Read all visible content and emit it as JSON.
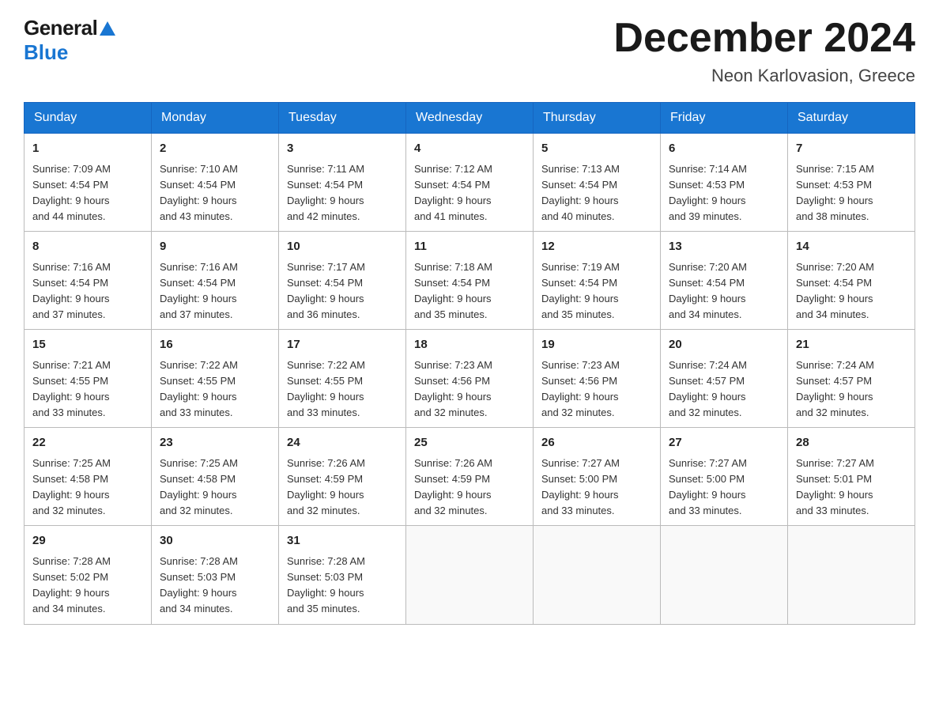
{
  "header": {
    "logo_general": "General",
    "logo_blue": "Blue",
    "month_title": "December 2024",
    "location": "Neon Karlovasion, Greece"
  },
  "weekdays": [
    "Sunday",
    "Monday",
    "Tuesday",
    "Wednesday",
    "Thursday",
    "Friday",
    "Saturday"
  ],
  "weeks": [
    [
      {
        "day": "1",
        "sunrise": "7:09 AM",
        "sunset": "4:54 PM",
        "daylight": "9 hours and 44 minutes."
      },
      {
        "day": "2",
        "sunrise": "7:10 AM",
        "sunset": "4:54 PM",
        "daylight": "9 hours and 43 minutes."
      },
      {
        "day": "3",
        "sunrise": "7:11 AM",
        "sunset": "4:54 PM",
        "daylight": "9 hours and 42 minutes."
      },
      {
        "day": "4",
        "sunrise": "7:12 AM",
        "sunset": "4:54 PM",
        "daylight": "9 hours and 41 minutes."
      },
      {
        "day": "5",
        "sunrise": "7:13 AM",
        "sunset": "4:54 PM",
        "daylight": "9 hours and 40 minutes."
      },
      {
        "day": "6",
        "sunrise": "7:14 AM",
        "sunset": "4:53 PM",
        "daylight": "9 hours and 39 minutes."
      },
      {
        "day": "7",
        "sunrise": "7:15 AM",
        "sunset": "4:53 PM",
        "daylight": "9 hours and 38 minutes."
      }
    ],
    [
      {
        "day": "8",
        "sunrise": "7:16 AM",
        "sunset": "4:54 PM",
        "daylight": "9 hours and 37 minutes."
      },
      {
        "day": "9",
        "sunrise": "7:16 AM",
        "sunset": "4:54 PM",
        "daylight": "9 hours and 37 minutes."
      },
      {
        "day": "10",
        "sunrise": "7:17 AM",
        "sunset": "4:54 PM",
        "daylight": "9 hours and 36 minutes."
      },
      {
        "day": "11",
        "sunrise": "7:18 AM",
        "sunset": "4:54 PM",
        "daylight": "9 hours and 35 minutes."
      },
      {
        "day": "12",
        "sunrise": "7:19 AM",
        "sunset": "4:54 PM",
        "daylight": "9 hours and 35 minutes."
      },
      {
        "day": "13",
        "sunrise": "7:20 AM",
        "sunset": "4:54 PM",
        "daylight": "9 hours and 34 minutes."
      },
      {
        "day": "14",
        "sunrise": "7:20 AM",
        "sunset": "4:54 PM",
        "daylight": "9 hours and 34 minutes."
      }
    ],
    [
      {
        "day": "15",
        "sunrise": "7:21 AM",
        "sunset": "4:55 PM",
        "daylight": "9 hours and 33 minutes."
      },
      {
        "day": "16",
        "sunrise": "7:22 AM",
        "sunset": "4:55 PM",
        "daylight": "9 hours and 33 minutes."
      },
      {
        "day": "17",
        "sunrise": "7:22 AM",
        "sunset": "4:55 PM",
        "daylight": "9 hours and 33 minutes."
      },
      {
        "day": "18",
        "sunrise": "7:23 AM",
        "sunset": "4:56 PM",
        "daylight": "9 hours and 32 minutes."
      },
      {
        "day": "19",
        "sunrise": "7:23 AM",
        "sunset": "4:56 PM",
        "daylight": "9 hours and 32 minutes."
      },
      {
        "day": "20",
        "sunrise": "7:24 AM",
        "sunset": "4:57 PM",
        "daylight": "9 hours and 32 minutes."
      },
      {
        "day": "21",
        "sunrise": "7:24 AM",
        "sunset": "4:57 PM",
        "daylight": "9 hours and 32 minutes."
      }
    ],
    [
      {
        "day": "22",
        "sunrise": "7:25 AM",
        "sunset": "4:58 PM",
        "daylight": "9 hours and 32 minutes."
      },
      {
        "day": "23",
        "sunrise": "7:25 AM",
        "sunset": "4:58 PM",
        "daylight": "9 hours and 32 minutes."
      },
      {
        "day": "24",
        "sunrise": "7:26 AM",
        "sunset": "4:59 PM",
        "daylight": "9 hours and 32 minutes."
      },
      {
        "day": "25",
        "sunrise": "7:26 AM",
        "sunset": "4:59 PM",
        "daylight": "9 hours and 32 minutes."
      },
      {
        "day": "26",
        "sunrise": "7:27 AM",
        "sunset": "5:00 PM",
        "daylight": "9 hours and 33 minutes."
      },
      {
        "day": "27",
        "sunrise": "7:27 AM",
        "sunset": "5:00 PM",
        "daylight": "9 hours and 33 minutes."
      },
      {
        "day": "28",
        "sunrise": "7:27 AM",
        "sunset": "5:01 PM",
        "daylight": "9 hours and 33 minutes."
      }
    ],
    [
      {
        "day": "29",
        "sunrise": "7:28 AM",
        "sunset": "5:02 PM",
        "daylight": "9 hours and 34 minutes."
      },
      {
        "day": "30",
        "sunrise": "7:28 AM",
        "sunset": "5:03 PM",
        "daylight": "9 hours and 34 minutes."
      },
      {
        "day": "31",
        "sunrise": "7:28 AM",
        "sunset": "5:03 PM",
        "daylight": "9 hours and 35 minutes."
      },
      null,
      null,
      null,
      null
    ]
  ],
  "labels": {
    "sunrise": "Sunrise:",
    "sunset": "Sunset:",
    "daylight": "Daylight:"
  }
}
